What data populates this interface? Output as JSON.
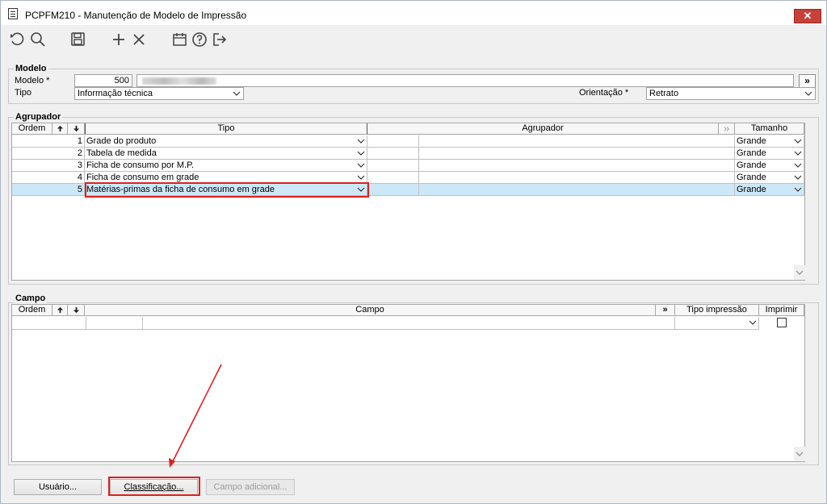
{
  "window": {
    "title": "PCPFM210 - Manutenção de Modelo de Impressão",
    "close_label": "✕"
  },
  "toolbar": {
    "icons": [
      "undo-icon",
      "search-icon",
      "save-icon",
      "add-icon",
      "delete-icon",
      "calendar-icon",
      "help-icon",
      "exit-icon"
    ]
  },
  "modelo": {
    "section_title": "Modelo",
    "modelo_label": "Modelo *",
    "modelo_value": "500",
    "more_button": "»",
    "tipo_label": "Tipo",
    "tipo_value": "Informação técnica",
    "orientacao_label": "Orientação *",
    "orientacao_value": "Retrato"
  },
  "agrupador": {
    "section_title": "Agrupador",
    "headers": {
      "ordem": "Ordem",
      "up": "🠕",
      "down": "🠗",
      "tipo": "Tipo",
      "agrupador": "Agrupador",
      "tamanho": "Tamanho"
    },
    "rows": [
      {
        "ordem": "1",
        "tipo": "Grade do produto",
        "agrupador": "",
        "tamanho": "Grande"
      },
      {
        "ordem": "2",
        "tipo": "Tabela de medida",
        "agrupador": "",
        "tamanho": "Grande"
      },
      {
        "ordem": "3",
        "tipo": "Ficha de consumo por M.P.",
        "agrupador": "",
        "tamanho": "Grande"
      },
      {
        "ordem": "4",
        "tipo": "Ficha de consumo em grade",
        "agrupador": "",
        "tamanho": "Grande"
      },
      {
        "ordem": "5",
        "tipo": "Matérias-primas da ficha de consumo em grade",
        "agrupador": "",
        "tamanho": "Grande"
      }
    ]
  },
  "campo": {
    "section_title": "Campo",
    "headers": {
      "ordem": "Ordem",
      "campo": "Campo",
      "more": "»",
      "tipo_impressao": "Tipo impressão",
      "imprimir": "Imprimir"
    }
  },
  "buttons": {
    "usuario": "Usuário...",
    "classificacao": "Classificação...",
    "campo_adicional": "Campo adicional..."
  },
  "colors": {
    "selected_row": "#cce8f8",
    "highlight": "#e02020",
    "close": "#c8403a"
  }
}
